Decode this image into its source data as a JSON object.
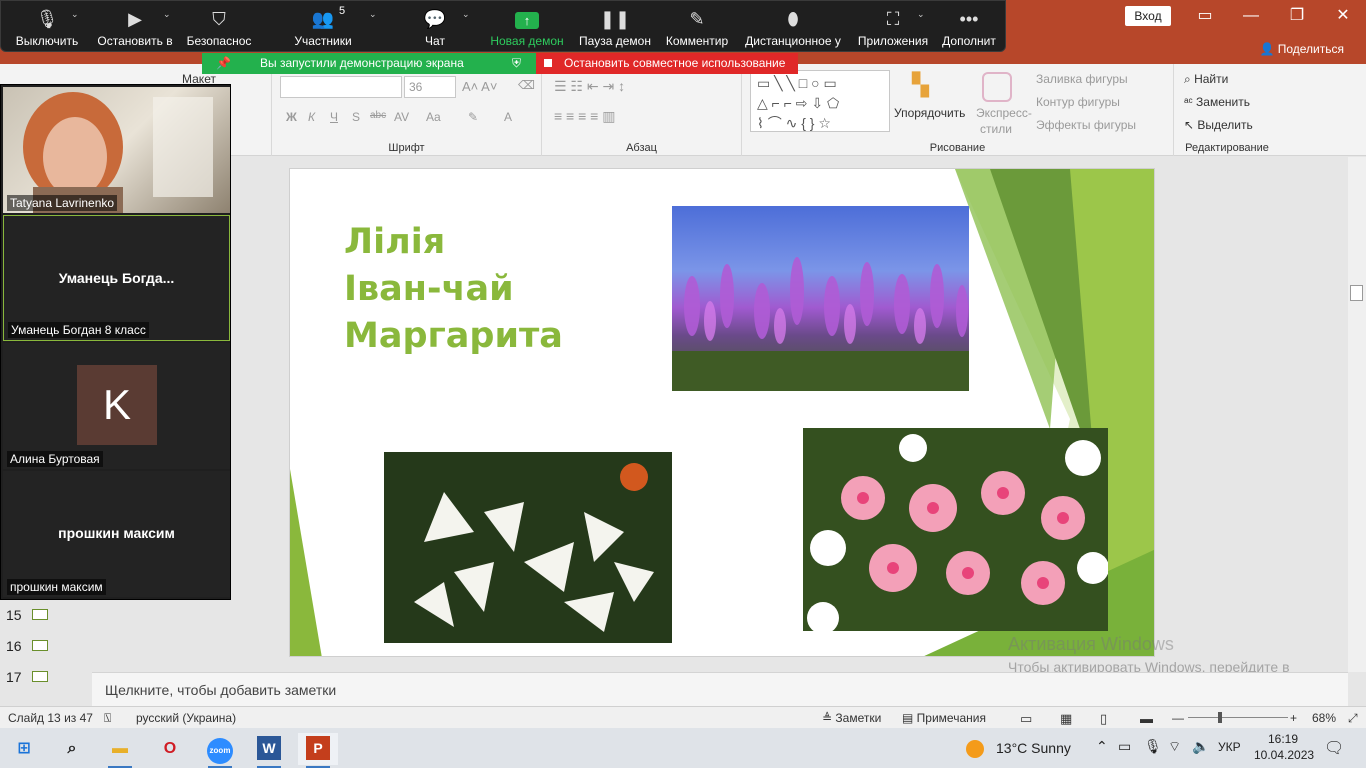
{
  "ppt": {
    "login": "Вход",
    "share": "Поделиться",
    "ribbon": {
      "layout": "Макет",
      "font_size": "36",
      "font_group": "Шрифт",
      "paragraph_group": "Абзац",
      "drawing_group": "Рисование",
      "editing_group": "Редактирование",
      "arrange": "Упорядочить",
      "quick_styles_1": "Экспресс-",
      "quick_styles_2": "стили",
      "fill": "Заливка фигуры",
      "outline": "Контур фигуры",
      "effects": "Эффекты фигуры",
      "find": "Найти",
      "replace": "Заменить",
      "select": "Выделить",
      "bold": "Ж",
      "italic": "К",
      "underline": "Ч",
      "shadow": "S",
      "strike": "abc",
      "spacing": "AV",
      "case": "Aa",
      "color": "A"
    },
    "slide": {
      "title_lines": [
        "Лілія",
        "Іван-чай",
        "Маргарита"
      ]
    },
    "notes_placeholder": "Щелкните, чтобы добавить заметки",
    "thumbs": [
      "15",
      "16",
      "17"
    ],
    "status": {
      "slide_info": "Слайд 13 из 47",
      "language": "русский (Украина)",
      "notes": "Заметки",
      "comments": "Примечания",
      "zoom": "68%"
    },
    "watermark": {
      "title": "Активация Windows",
      "text": "Чтобы активировать Windows, перейдите в раздел \"Параметры\"."
    }
  },
  "zoom": {
    "buttons": [
      {
        "label": "Выключить",
        "icon": "mic-icon"
      },
      {
        "label": "Остановить в",
        "icon": "video-icon"
      },
      {
        "label": "Безопаснос",
        "icon": "shield-icon"
      },
      {
        "label": "Участники",
        "icon": "participants-icon",
        "count": "5"
      },
      {
        "label": "Чат",
        "icon": "chat-icon"
      },
      {
        "label": "Новая демон",
        "icon": "share-screen-icon"
      },
      {
        "label": "Пауза демон",
        "icon": "pause-icon"
      },
      {
        "label": "Комментир",
        "icon": "pen-icon"
      },
      {
        "label": "Дистанционное у",
        "icon": "remote-control-icon"
      },
      {
        "label": "Приложения",
        "icon": "apps-icon"
      },
      {
        "label": "Дополнит",
        "icon": "more-icon"
      }
    ],
    "share_banner": "Вы запустили демонстрацию экрана",
    "stop_banner": "Остановить совместное использование",
    "participants": [
      {
        "name": "Tatyana Lavrinenko"
      },
      {
        "display": "Уманець  Богда...",
        "name": "Уманець Богдан 8 класс"
      },
      {
        "initial": "K",
        "name": "Алина Буртовая"
      },
      {
        "display": "прошкин максим",
        "name": "прошкин максим"
      }
    ]
  },
  "taskbar": {
    "weather": "13°C  Sunny",
    "lang": "УКР",
    "time": "16:19",
    "date": "10.04.2023"
  }
}
